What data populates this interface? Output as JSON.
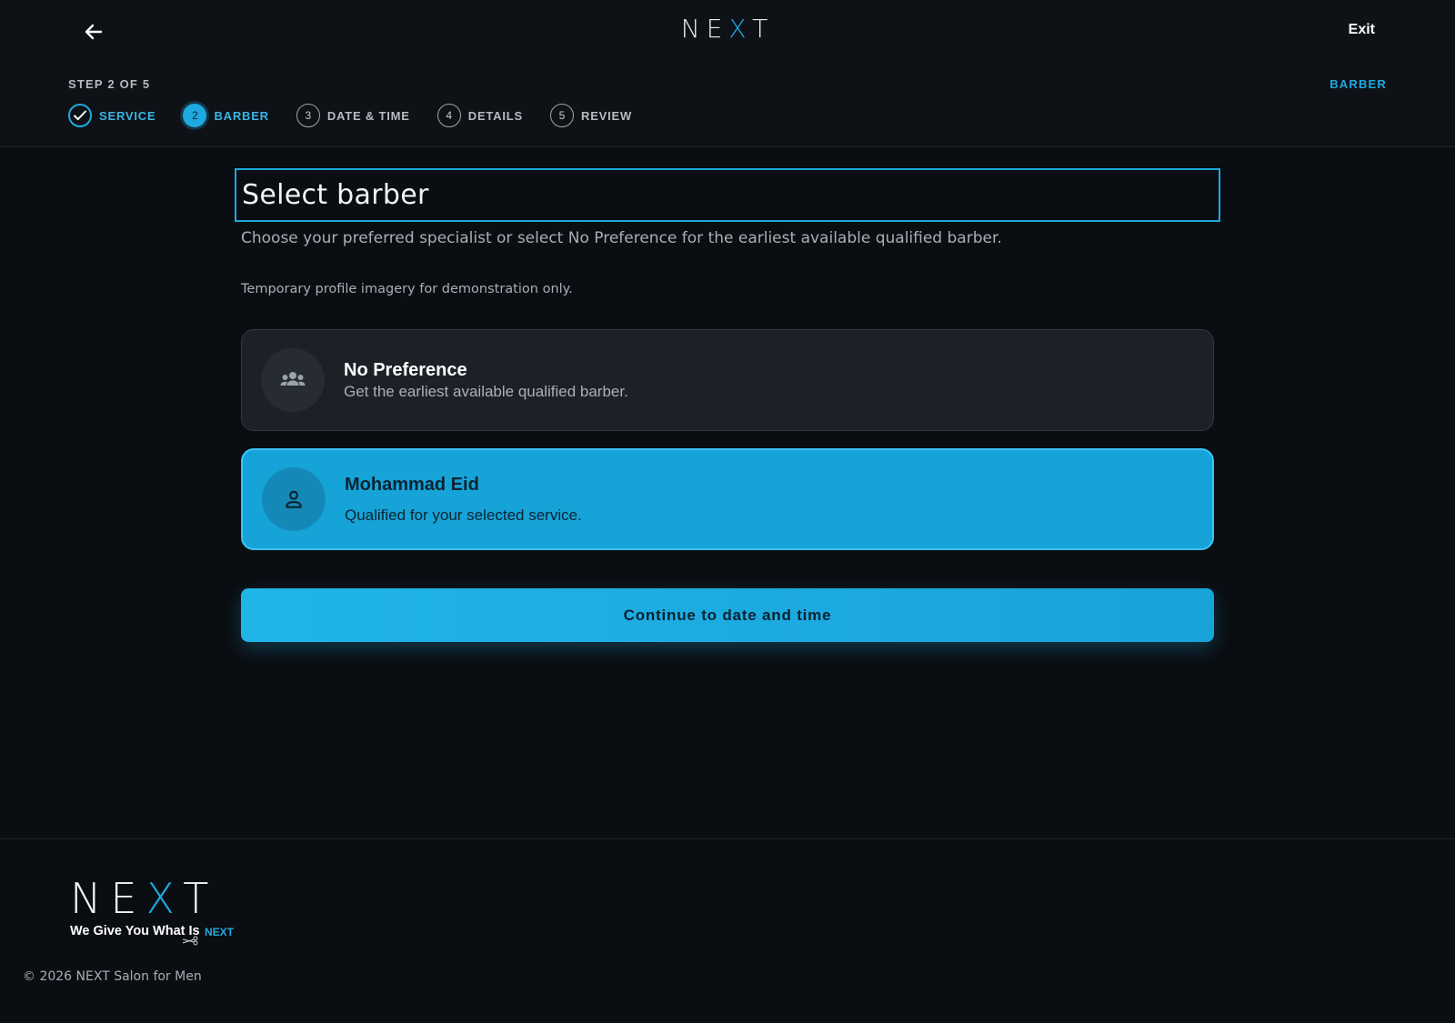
{
  "header": {
    "logo": {
      "before": "NE",
      "accent": "X",
      "after": "T"
    },
    "exit_label": "Exit",
    "step_count": "STEP 2 OF 5",
    "current_step_label": "BARBER",
    "steps": [
      {
        "number": "",
        "label": "SERVICE",
        "state": "done"
      },
      {
        "number": "2",
        "label": "BARBER",
        "state": "active"
      },
      {
        "number": "3",
        "label": "DATE & TIME",
        "state": "pending"
      },
      {
        "number": "4",
        "label": "DETAILS",
        "state": "pending"
      },
      {
        "number": "5",
        "label": "REVIEW",
        "state": "pending"
      }
    ]
  },
  "main": {
    "title": "Select barber",
    "subtitle": "Choose your preferred specialist or select No Preference for the earliest available qualified barber.",
    "demo_note": "Temporary profile imagery for demonstration only.",
    "options": [
      {
        "name": "No Preference",
        "description": "Get the earliest available qualified barber.",
        "icon": "group-icon",
        "selected": false
      },
      {
        "name": "Mohammad Eid",
        "description": "Qualified for your selected service.",
        "icon": "person-icon",
        "selected": true
      }
    ],
    "continue_label": "Continue to date and time"
  },
  "footer": {
    "logo": {
      "before": "NE",
      "accent": "X",
      "after": "T"
    },
    "tagline": "We Give You What Is",
    "tagline_brand": "NEXT",
    "copyright": "© 2026 NEXT Salon for Men"
  },
  "colors": {
    "accent": "#1ea9e0",
    "background": "#0a0d11",
    "card": "#1d2127",
    "selected_card": "#16a3d8"
  }
}
